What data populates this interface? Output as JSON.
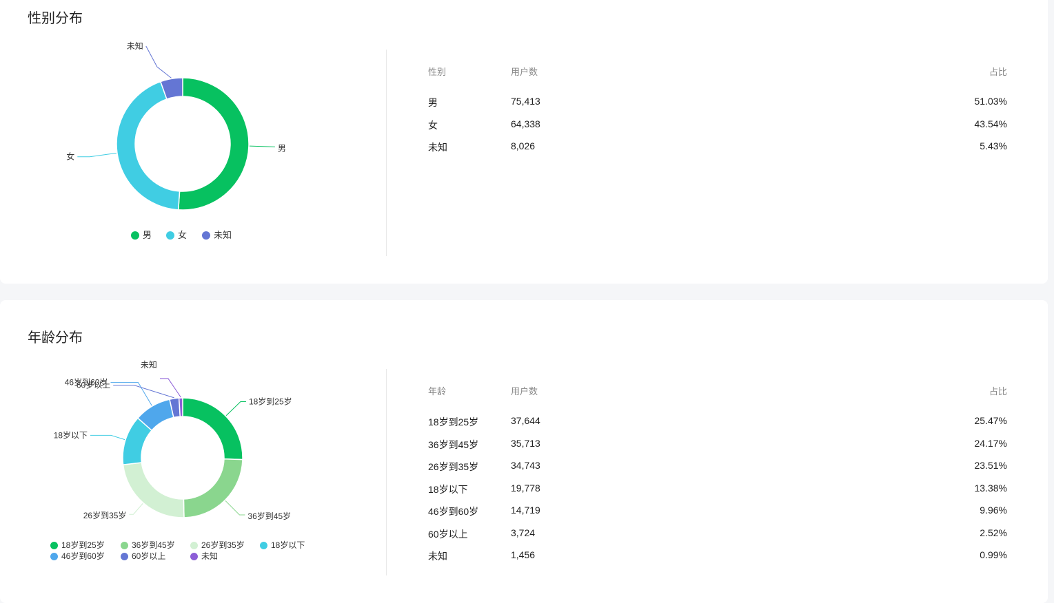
{
  "gender": {
    "title": "性别分布",
    "headers": [
      "性别",
      "用户数",
      "占比"
    ],
    "rows": [
      {
        "label": "男",
        "count": "75,413",
        "pct": "51.03%"
      },
      {
        "label": "女",
        "count": "64,338",
        "pct": "43.54%"
      },
      {
        "label": "未知",
        "count": "8,026",
        "pct": "5.43%"
      }
    ]
  },
  "age": {
    "title": "年龄分布",
    "headers": [
      "年龄",
      "用户数",
      "占比"
    ],
    "rows": [
      {
        "label": "18岁到25岁",
        "count": "37,644",
        "pct": "25.47%"
      },
      {
        "label": "36岁到45岁",
        "count": "35,713",
        "pct": "24.17%"
      },
      {
        "label": "26岁到35岁",
        "count": "34,743",
        "pct": "23.51%"
      },
      {
        "label": "18岁以下",
        "count": "19,778",
        "pct": "13.38%"
      },
      {
        "label": "46岁到60岁",
        "count": "14,719",
        "pct": "9.96%"
      },
      {
        "label": "60岁以上",
        "count": "3,724",
        "pct": "2.52%"
      },
      {
        "label": "未知",
        "count": "1,456",
        "pct": "0.99%"
      }
    ]
  },
  "chart_data": [
    {
      "type": "pie",
      "title": "性别分布",
      "donut": true,
      "categories": [
        "男",
        "女",
        "未知"
      ],
      "values": [
        75413,
        64338,
        8026
      ],
      "colors": [
        "#07c160",
        "#40cde3",
        "#6476d4"
      ],
      "legend": "bottom"
    },
    {
      "type": "pie",
      "title": "年龄分布",
      "donut": true,
      "categories": [
        "18岁到25岁",
        "36岁到45岁",
        "26岁到35岁",
        "18岁以下",
        "46岁到60岁",
        "60岁以上",
        "未知"
      ],
      "values": [
        37644,
        35713,
        34743,
        19778,
        14719,
        3724,
        1456
      ],
      "colors": [
        "#07c160",
        "#8ad68e",
        "#d2f0d3",
        "#40cde3",
        "#4fa7ec",
        "#6476d4",
        "#8c5ed7"
      ],
      "legend": "bottom"
    }
  ]
}
